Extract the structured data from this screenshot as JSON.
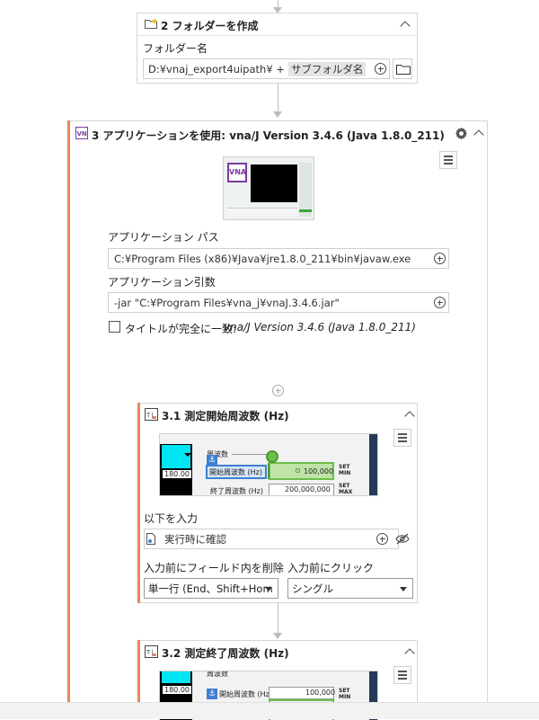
{
  "step2": {
    "number_title": "2 フォルダーを作成",
    "folder_label": "フォルダー名",
    "folder_path": "D:¥vnaj_export4uipath¥ +",
    "folder_token": "サブフォルダ名"
  },
  "step3": {
    "title": "3 アプリケーションを使用: vna/J Version 3.4.6 (Java 1.8.0_211)",
    "app_icon_text": "VNA",
    "app_path_label": "アプリケーション パス",
    "app_path_value": "C:¥Program Files (x86)¥Java¥jre1.8.0_211¥bin¥javaw.exe",
    "app_args_label": "アプリケーション引数",
    "app_args_value": "-jar \"C:¥Program Files¥vna_j¥vnaJ.3.4.6.jar\"",
    "exact_match_label": "タイトルが完全に一致:",
    "exact_match_value": "vna/J Version 3.4.6 (Java 1.8.0_211)"
  },
  "step31": {
    "title": "3.1 測定開始周波数 (Hz)",
    "preview": {
      "group": "周波数",
      "left_value": "180.00",
      "start_label": "開始周波数 (Hz)",
      "start_value": "100,000",
      "end_label": "終了周波数 (Hz)",
      "end_value": "200,000,000",
      "set_label": "SET",
      "min_label": "MIN",
      "max_label": "MAX"
    },
    "input_label": "以下を入力",
    "input_value": "実行時に確認",
    "clear_label": "入力前にフィールド内を削除",
    "clear_value": "単一行 (End、Shift+Hom",
    "click_label": "入力前にクリック",
    "click_value": "シングル"
  },
  "step32": {
    "title": "3.2 測定終了周波数 (Hz)",
    "preview": {
      "group": "周波数",
      "left_value": "180.00",
      "start_label": "開始周波数 (Hz)",
      "start_value": "100,000",
      "set_label": "SET",
      "min_label": "MIN"
    }
  },
  "colors": {
    "accent_orange": "#e8865a",
    "folder_yellow": "#f0c419",
    "app_purple": "#7a3aa0",
    "selection_green": "#6cbf4a",
    "selection_blue": "#3f7fd0"
  },
  "icons": [
    "folder-icon",
    "app-icon",
    "settings-gear-icon",
    "chevron-up-icon",
    "menu-icon",
    "plus-circle-icon",
    "browse-folder-icon",
    "type-into-icon",
    "eye-off-icon",
    "file-lock-icon"
  ]
}
